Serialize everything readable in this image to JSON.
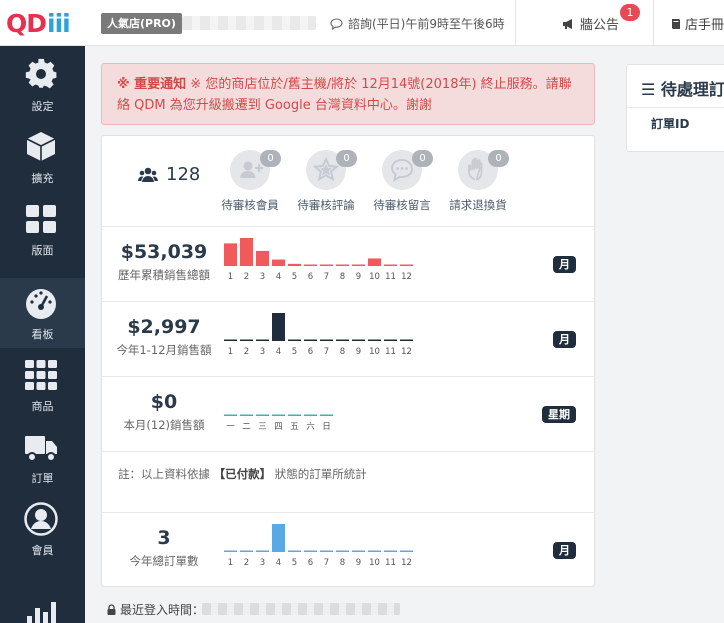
{
  "header": {
    "logo": {
      "q": "Q",
      "d": "D",
      "iii": "iii"
    },
    "plan_badge": "人氣店(PRO)",
    "hotline": "諮詢(平日)午前9時至午後6時",
    "announcements_label": "牆公告",
    "announcements_count": "1",
    "manual_label": "店手冊"
  },
  "sidebar": {
    "items": [
      {
        "label": "設定",
        "icon": "gear-icon"
      },
      {
        "label": "擴充",
        "icon": "cube-icon"
      },
      {
        "label": "版面",
        "icon": "grid-icon"
      },
      {
        "label": "看板",
        "icon": "dashboard-icon"
      },
      {
        "label": "商品",
        "icon": "apps-icon"
      },
      {
        "label": "訂單",
        "icon": "truck-icon"
      },
      {
        "label": "會員",
        "icon": "user-icon"
      },
      {
        "label": "",
        "icon": "bar-chart-icon"
      }
    ]
  },
  "notice": {
    "prefix": "※ 重要通知",
    "text": " ※ 您的商店位於/舊主機/將於 12月14號(2018年) 終止服務。請聯絡 QDM 為您升級搬遷到 Google 台灣資料中心。謝謝"
  },
  "overview": {
    "members_count": "128",
    "pending": [
      {
        "label": "待審核會員",
        "count": "0",
        "icon": "user-plus-icon"
      },
      {
        "label": "待審核評論",
        "count": "0",
        "icon": "star-icon"
      },
      {
        "label": "待審核留言",
        "count": "0",
        "icon": "comment-icon"
      },
      {
        "label": "請求退換貨",
        "count": "0",
        "icon": "hand-icon"
      }
    ]
  },
  "stats": [
    {
      "amount": "$53,039",
      "label": "歷年累積銷售總額",
      "period": "月",
      "color": "#f05a5b"
    },
    {
      "amount": "$2,997",
      "label": "今年1-12月銷售額",
      "period": "月",
      "color": "#1f2d3d"
    },
    {
      "amount": "$0",
      "label": "本月(12)銷售額",
      "period": "星期",
      "color": "#3bb7a6"
    },
    {
      "amount": "3",
      "label": "今年總訂單數",
      "period": "月",
      "color": "#5aa9e6"
    }
  ],
  "chart_data": [
    {
      "type": "bar",
      "categories": [
        "1",
        "2",
        "3",
        "4",
        "5",
        "6",
        "7",
        "8",
        "9",
        "10",
        "11",
        "12"
      ],
      "values": [
        10.5,
        13.0,
        7.0,
        3.0,
        1.0,
        0.5,
        0.5,
        0.5,
        0.5,
        3.5,
        0.5,
        0.5
      ],
      "ylim": [
        0,
        13
      ]
    },
    {
      "type": "bar",
      "categories": [
        "1",
        "2",
        "3",
        "4",
        "5",
        "6",
        "7",
        "8",
        "9",
        "10",
        "11",
        "12"
      ],
      "values": [
        0,
        0,
        0,
        2997,
        0,
        0,
        0,
        0,
        0,
        0,
        0,
        0
      ],
      "ylim": [
        0,
        2997
      ]
    },
    {
      "type": "bar",
      "categories": [
        "一",
        "二",
        "三",
        "四",
        "五",
        "六",
        "日"
      ],
      "values": [
        0,
        0,
        0,
        0,
        0,
        0,
        0
      ],
      "ylim": [
        0,
        1
      ]
    },
    {
      "type": "bar",
      "categories": [
        "1",
        "2",
        "3",
        "4",
        "5",
        "6",
        "7",
        "8",
        "9",
        "10",
        "11",
        "12"
      ],
      "values": [
        0,
        0,
        0,
        3,
        0,
        0,
        0,
        0,
        0,
        0,
        0,
        0
      ],
      "ylim": [
        0,
        3
      ]
    }
  ],
  "footnote": {
    "prefix": "註：以上資料依據 ",
    "bold": "【已付款】",
    "suffix": " 狀態的訂單所統計"
  },
  "right_panel": {
    "title": "待處理訂",
    "column": "訂單ID"
  },
  "footer": {
    "last_login_label": "最近登入時間："
  }
}
